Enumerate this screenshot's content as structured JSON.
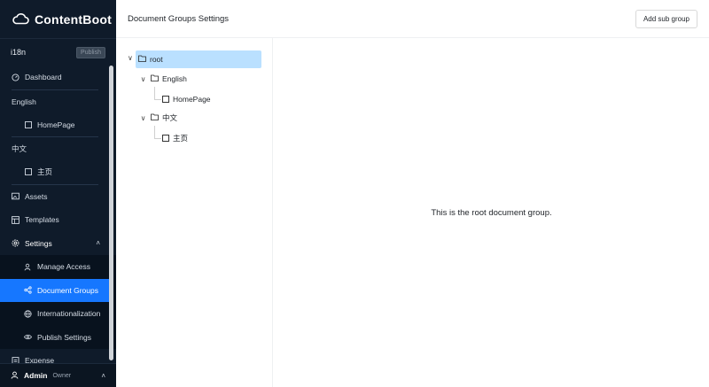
{
  "brand": {
    "name": "ContentBoot"
  },
  "project": {
    "name": "i18n",
    "publish_label": "Publish"
  },
  "sidebar": {
    "dashboard": "Dashboard",
    "group_english": "English",
    "english_homepage": "HomePage",
    "group_chinese": "中文",
    "chinese_homepage": "主页",
    "assets": "Assets",
    "templates": "Templates",
    "settings": "Settings",
    "manage_access": "Manage Access",
    "document_groups": "Document Groups",
    "internationalization": "Internationalization",
    "publish_settings": "Publish Settings",
    "expense": "Expense"
  },
  "user": {
    "name": "Admin",
    "role": "Owner"
  },
  "header": {
    "title": "Document Groups Settings",
    "add_sub_group": "Add sub group"
  },
  "tree": {
    "root": "root",
    "english": "English",
    "english_home": "HomePage",
    "chinese": "中文",
    "chinese_home": "主页"
  },
  "content": {
    "message": "This is the root document group."
  },
  "colors": {
    "sidebar_bg": "#0f1b2a",
    "active": "#1677ff",
    "tree_selected": "#bae0ff"
  }
}
